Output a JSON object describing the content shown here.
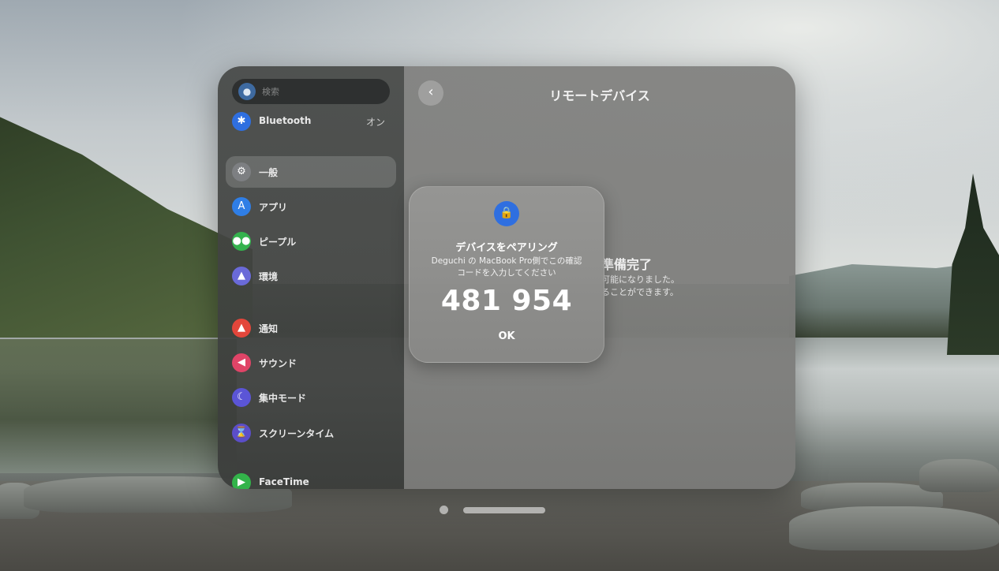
{
  "sidebar": {
    "search_placeholder": "検索",
    "bluetooth": {
      "label": "Bluetooth",
      "value": "オン"
    },
    "items": [
      {
        "label": "一般",
        "icon": "gear-icon",
        "color": "#7d7f82",
        "selected": true
      },
      {
        "label": "アプリ",
        "icon": "app-store-icon",
        "color": "#2f7ee6"
      },
      {
        "label": "ピープル",
        "icon": "people-icon",
        "color": "#34b24d"
      },
      {
        "label": "環境",
        "icon": "environment-icon",
        "color": "#6a6ad8"
      },
      {
        "label": "通知",
        "icon": "bell-icon",
        "color": "#e3463b"
      },
      {
        "label": "サウンド",
        "icon": "speaker-icon",
        "color": "#e04467"
      },
      {
        "label": "集中モード",
        "icon": "moon-icon",
        "color": "#5b55d6"
      },
      {
        "label": "スクリーンタイム",
        "icon": "hourglass-icon",
        "color": "#5b4ec9"
      },
      {
        "label": "FaceTime",
        "icon": "facetime-icon",
        "color": "#33b34a"
      }
    ]
  },
  "main": {
    "title": "リモートデバイス",
    "background_heading": "準備完了",
    "background_line1": "可能になりました。",
    "background_line2": "ることができます。"
  },
  "dialog": {
    "icon": "lock-icon",
    "title": "デバイスをペアリング",
    "message_line1": "Deguchi の MacBook Pro側でこの確認",
    "message_line2": "コードを入力してください",
    "code": "481 954",
    "ok_label": "OK"
  }
}
